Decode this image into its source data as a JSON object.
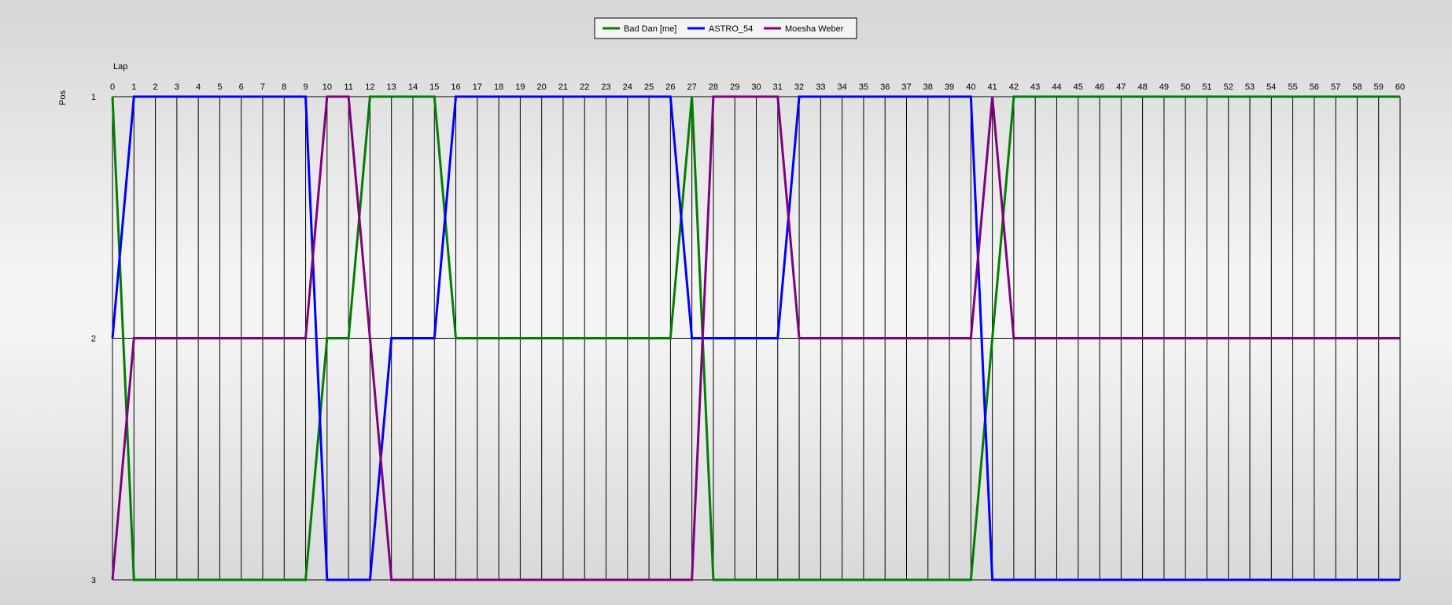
{
  "chart_data": {
    "type": "line",
    "title": "",
    "xlabel": "Lap",
    "ylabel": "Pos",
    "xlim": [
      0,
      60
    ],
    "ylim": [
      1,
      3
    ],
    "y_inverted": true,
    "x_ticks": [
      0,
      1,
      2,
      3,
      4,
      5,
      6,
      7,
      8,
      9,
      10,
      11,
      12,
      13,
      14,
      15,
      16,
      17,
      18,
      19,
      20,
      21,
      22,
      23,
      24,
      25,
      26,
      27,
      28,
      29,
      30,
      31,
      32,
      33,
      34,
      35,
      36,
      37,
      38,
      39,
      40,
      41,
      42,
      43,
      44,
      45,
      46,
      47,
      48,
      49,
      50,
      51,
      52,
      53,
      54,
      55,
      56,
      57,
      58,
      59,
      60
    ],
    "y_ticks": [
      1,
      2,
      3
    ],
    "grid": "vertical-per-lap",
    "legend_position": "top-center",
    "series": [
      {
        "name": "Bad Dan [me]",
        "color": "#008000",
        "values": [
          1,
          3,
          3,
          3,
          3,
          3,
          3,
          3,
          3,
          3,
          2,
          2,
          1,
          1,
          1,
          1,
          2,
          2,
          2,
          2,
          2,
          2,
          2,
          2,
          2,
          2,
          2,
          1,
          3,
          3,
          3,
          3,
          3,
          3,
          3,
          3,
          3,
          3,
          3,
          3,
          3,
          2,
          1,
          1,
          1,
          1,
          1,
          1,
          1,
          1,
          1,
          1,
          1,
          1,
          1,
          1,
          1,
          1,
          1,
          1,
          1
        ]
      },
      {
        "name": "ASTRO_54",
        "color": "#0000ff",
        "values": [
          2,
          1,
          1,
          1,
          1,
          1,
          1,
          1,
          1,
          1,
          3,
          3,
          3,
          2,
          2,
          2,
          1,
          1,
          1,
          1,
          1,
          1,
          1,
          1,
          1,
          1,
          1,
          2,
          2,
          2,
          2,
          2,
          1,
          1,
          1,
          1,
          1,
          1,
          1,
          1,
          1,
          3,
          3,
          3,
          3,
          3,
          3,
          3,
          3,
          3,
          3,
          3,
          3,
          3,
          3,
          3,
          3,
          3,
          3,
          3,
          3
        ]
      },
      {
        "name": "Moesha Weber",
        "color": "#800080",
        "values": [
          3,
          2,
          2,
          2,
          2,
          2,
          2,
          2,
          2,
          2,
          1,
          1,
          2,
          3,
          3,
          3,
          3,
          3,
          3,
          3,
          3,
          3,
          3,
          3,
          3,
          3,
          3,
          3,
          1,
          1,
          1,
          1,
          2,
          2,
          2,
          2,
          2,
          2,
          2,
          2,
          2,
          1,
          2,
          2,
          2,
          2,
          2,
          2,
          2,
          2,
          2,
          2,
          2,
          2,
          2,
          2,
          2,
          2,
          2,
          2,
          2
        ]
      }
    ]
  }
}
